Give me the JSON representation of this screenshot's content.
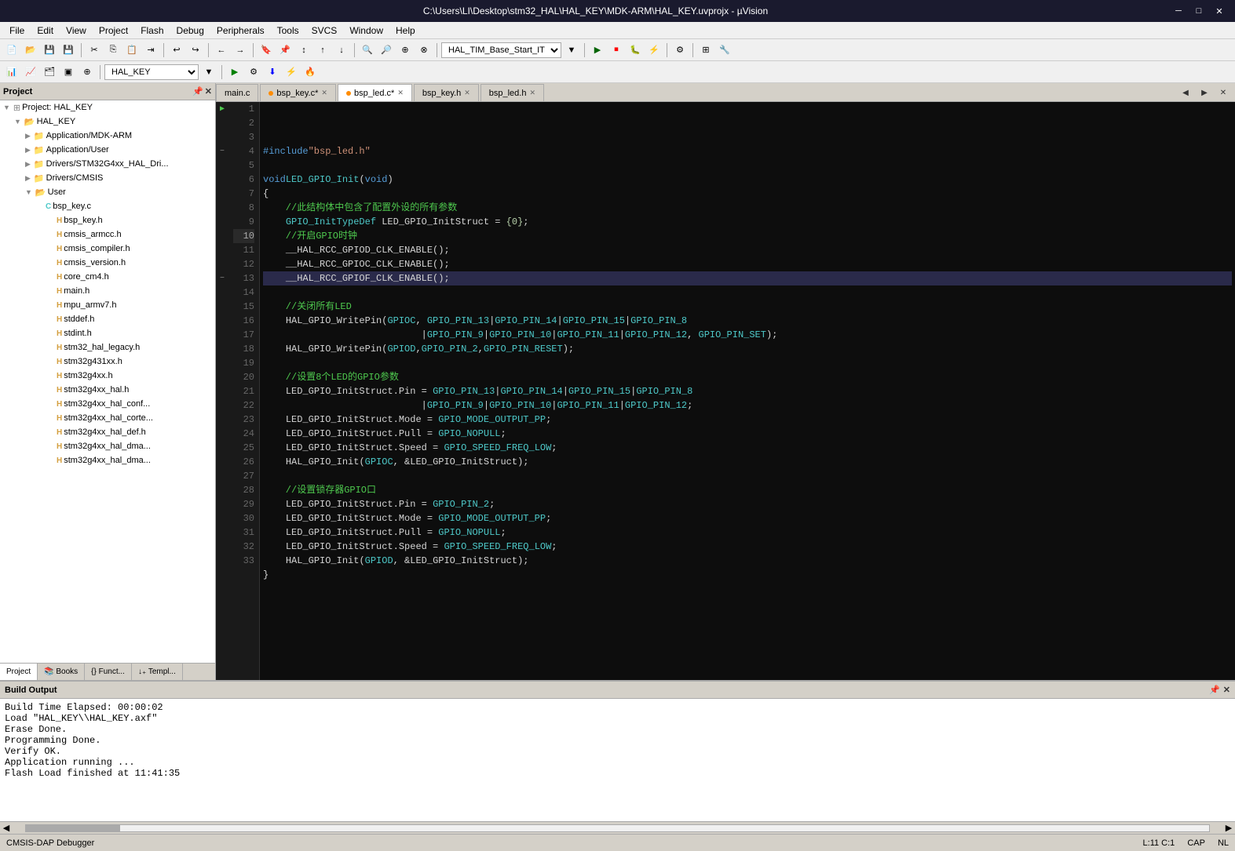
{
  "titleBar": {
    "title": "C:\\Users\\LI\\Desktop\\stm32_HAL\\HAL_KEY\\MDK-ARM\\HAL_KEY.uvprojx - µVision",
    "minimize": "─",
    "maximize": "□",
    "close": "✕"
  },
  "menuBar": {
    "items": [
      "File",
      "Edit",
      "View",
      "Project",
      "Flash",
      "Debug",
      "Peripherals",
      "Tools",
      "SVCS",
      "Window",
      "Help"
    ]
  },
  "toolbar1": {
    "dropdown": "HAL_TIM_Base_Start_IT"
  },
  "toolbar2": {
    "dropdown": "HAL_KEY"
  },
  "sidebar": {
    "title": "Project",
    "tree": [
      {
        "id": "project-root",
        "label": "Project: HAL_KEY",
        "indent": 0,
        "type": "project",
        "expanded": true
      },
      {
        "id": "hal-key",
        "label": "HAL_KEY",
        "indent": 1,
        "type": "folder",
        "expanded": true
      },
      {
        "id": "app-mdk",
        "label": "Application/MDK-ARM",
        "indent": 2,
        "type": "folder",
        "expanded": false
      },
      {
        "id": "app-user",
        "label": "Application/User",
        "indent": 2,
        "type": "folder",
        "expanded": false
      },
      {
        "id": "drivers-stm32",
        "label": "Drivers/STM32G4xx_HAL_Dri...",
        "indent": 2,
        "type": "folder",
        "expanded": false
      },
      {
        "id": "drivers-cmsis",
        "label": "Drivers/CMSIS",
        "indent": 2,
        "type": "folder",
        "expanded": false
      },
      {
        "id": "user",
        "label": "User",
        "indent": 2,
        "type": "folder",
        "expanded": true
      },
      {
        "id": "bsp-key-c",
        "label": "bsp_key.c",
        "indent": 3,
        "type": "c-file",
        "expanded": true
      },
      {
        "id": "bsp-key-h",
        "label": "bsp_key.h",
        "indent": 4,
        "type": "h-file"
      },
      {
        "id": "cmsis-armcc-h",
        "label": "cmsis_armcc.h",
        "indent": 4,
        "type": "h-file"
      },
      {
        "id": "cmsis-compiler-h",
        "label": "cmsis_compiler.h",
        "indent": 4,
        "type": "h-file"
      },
      {
        "id": "cmsis-version-h",
        "label": "cmsis_version.h",
        "indent": 4,
        "type": "h-file"
      },
      {
        "id": "core-cm4-h",
        "label": "core_cm4.h",
        "indent": 4,
        "type": "h-file"
      },
      {
        "id": "main-h",
        "label": "main.h",
        "indent": 4,
        "type": "h-file"
      },
      {
        "id": "mpu-armv7-h",
        "label": "mpu_armv7.h",
        "indent": 4,
        "type": "h-file"
      },
      {
        "id": "stddef-h",
        "label": "stddef.h",
        "indent": 4,
        "type": "h-file"
      },
      {
        "id": "stdint-h",
        "label": "stdint.h",
        "indent": 4,
        "type": "h-file"
      },
      {
        "id": "stm32-hal-legacy-h",
        "label": "stm32_hal_legacy.h",
        "indent": 4,
        "type": "h-file"
      },
      {
        "id": "stm32g431xx-h",
        "label": "stm32g431xx.h",
        "indent": 4,
        "type": "h-file"
      },
      {
        "id": "stm32g4xx-h",
        "label": "stm32g4xx.h",
        "indent": 4,
        "type": "h-file"
      },
      {
        "id": "stm32g4xx-hal-h",
        "label": "stm32g4xx_hal.h",
        "indent": 4,
        "type": "h-file"
      },
      {
        "id": "stm32g4xx-hal-conf-h",
        "label": "stm32g4xx_hal_conf...",
        "indent": 4,
        "type": "h-file"
      },
      {
        "id": "stm32g4xx-hal-corte-h",
        "label": "stm32g4xx_hal_corte...",
        "indent": 4,
        "type": "h-file"
      },
      {
        "id": "stm32g4xx-hal-def-h",
        "label": "stm32g4xx_hal_def.h",
        "indent": 4,
        "type": "h-file"
      },
      {
        "id": "stm32g4xx-hal-dma1-h",
        "label": "stm32g4xx_hal_dma...",
        "indent": 4,
        "type": "h-file"
      },
      {
        "id": "stm32g4xx-hal-dma2-h",
        "label": "stm32g4xx_hal_dma...",
        "indent": 4,
        "type": "h-file"
      }
    ],
    "tabs": [
      "Project",
      "Books",
      "{} Funct...",
      "↓₊ Templ..."
    ]
  },
  "editorTabs": [
    {
      "id": "main-c",
      "label": "main.c",
      "active": false,
      "modified": false
    },
    {
      "id": "bsp-key-c",
      "label": "bsp_key.c*",
      "active": false,
      "modified": true
    },
    {
      "id": "bsp-led-c",
      "label": "bsp_led.c*",
      "active": true,
      "modified": true
    },
    {
      "id": "bsp-key-h2",
      "label": "bsp_key.h",
      "active": false,
      "modified": false
    },
    {
      "id": "bsp-led-h",
      "label": "bsp_led.h",
      "active": false,
      "modified": false
    }
  ],
  "codeLines": [
    {
      "num": 1,
      "text": "#include \"bsp_led.h\"",
      "type": "include"
    },
    {
      "num": 2,
      "text": "",
      "type": "blank"
    },
    {
      "num": 3,
      "text": "void LED_GPIO_Init(void)",
      "type": "code"
    },
    {
      "num": 4,
      "text": "{",
      "type": "code",
      "collapsed": true
    },
    {
      "num": 5,
      "text": "    //此结构体中包含了配置外设的所有参数",
      "type": "comment"
    },
    {
      "num": 6,
      "text": "    GPIO_InitTypeDef LED_GPIO_InitStruct = {0};",
      "type": "code"
    },
    {
      "num": 7,
      "text": "    //开启GPIO时钟",
      "type": "comment"
    },
    {
      "num": 8,
      "text": "    __HAL_RCC_GPIOD_CLK_ENABLE();",
      "type": "code"
    },
    {
      "num": 9,
      "text": "    __HAL_RCC_GPIOC_CLK_ENABLE();",
      "type": "code"
    },
    {
      "num": 10,
      "text": "    __HAL_RCC_GPIOF_CLK_ENABLE();",
      "type": "code",
      "current": true
    },
    {
      "num": 11,
      "text": "",
      "type": "blank"
    },
    {
      "num": 12,
      "text": "    //关闭所有LED",
      "type": "comment"
    },
    {
      "num": 13,
      "text": "    HAL_GPIO_WritePin(GPIOC, GPIO_PIN_13|GPIO_PIN_14|GPIO_PIN_15|GPIO_PIN_8",
      "type": "code",
      "collapsed": true
    },
    {
      "num": 14,
      "text": "                            |GPIO_PIN_9|GPIO_PIN_10|GPIO_PIN_11|GPIO_PIN_12, GPIO_PIN_SET);",
      "type": "code"
    },
    {
      "num": 15,
      "text": "    HAL_GPIO_WritePin(GPIOD,GPIO_PIN_2,GPIO_PIN_RESET);",
      "type": "code"
    },
    {
      "num": 16,
      "text": "",
      "type": "blank"
    },
    {
      "num": 17,
      "text": "    //设置8个LED的GPIO参数",
      "type": "comment"
    },
    {
      "num": 18,
      "text": "    LED_GPIO_InitStruct.Pin = GPIO_PIN_13|GPIO_PIN_14|GPIO_PIN_15|GPIO_PIN_8",
      "type": "code"
    },
    {
      "num": 19,
      "text": "                            |GPIO_PIN_9|GPIO_PIN_10|GPIO_PIN_11|GPIO_PIN_12;",
      "type": "code"
    },
    {
      "num": 20,
      "text": "    LED_GPIO_InitStruct.Mode = GPIO_MODE_OUTPUT_PP;",
      "type": "code"
    },
    {
      "num": 21,
      "text": "    LED_GPIO_InitStruct.Pull = GPIO_NOPULL;",
      "type": "code"
    },
    {
      "num": 22,
      "text": "    LED_GPIO_InitStruct.Speed = GPIO_SPEED_FREQ_LOW;",
      "type": "code"
    },
    {
      "num": 23,
      "text": "    HAL_GPIO_Init(GPIOC, &LED_GPIO_InitStruct);",
      "type": "code"
    },
    {
      "num": 24,
      "text": "",
      "type": "blank"
    },
    {
      "num": 25,
      "text": "    //设置锁存器GPIO口",
      "type": "comment"
    },
    {
      "num": 26,
      "text": "    LED_GPIO_InitStruct.Pin = GPIO_PIN_2;",
      "type": "code"
    },
    {
      "num": 27,
      "text": "    LED_GPIO_InitStruct.Mode = GPIO_MODE_OUTPUT_PP;",
      "type": "code"
    },
    {
      "num": 28,
      "text": "    LED_GPIO_InitStruct.Pull = GPIO_NOPULL;",
      "type": "code"
    },
    {
      "num": 29,
      "text": "    LED_GPIO_InitStruct.Speed = GPIO_SPEED_FREQ_LOW;",
      "type": "code"
    },
    {
      "num": 30,
      "text": "    HAL_GPIO_Init(GPIOD, &LED_GPIO_InitStruct);",
      "type": "code"
    },
    {
      "num": 31,
      "text": "}",
      "type": "code"
    },
    {
      "num": 32,
      "text": "",
      "type": "blank"
    },
    {
      "num": 33,
      "text": "",
      "type": "blank"
    }
  ],
  "buildOutput": {
    "title": "Build Output",
    "lines": [
      "Build Time Elapsed:  00:00:02",
      "Load \"HAL_KEY\\\\HAL_KEY.axf\"",
      "Erase Done.",
      "Programming Done.",
      "Verify OK.",
      "Application running ...",
      "Flash Load finished at 11:41:35"
    ]
  },
  "statusBar": {
    "left": "CMSIS-DAP Debugger",
    "lineCol": "L:11 C:1",
    "cap": "CAP",
    "nl": "NL"
  }
}
